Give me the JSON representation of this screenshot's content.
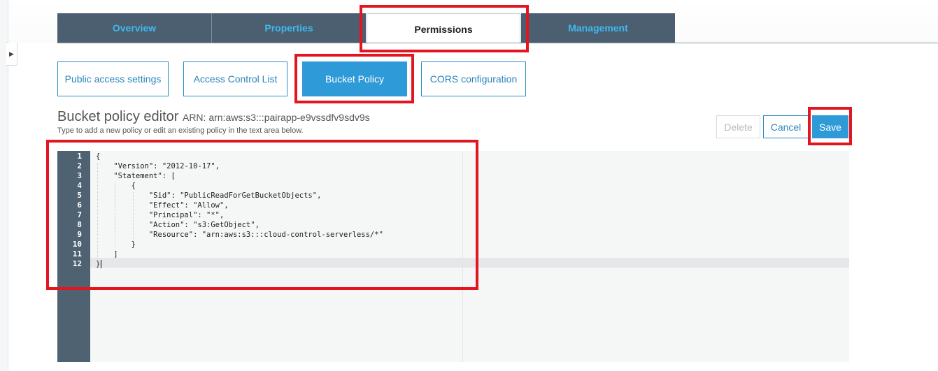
{
  "tabs": [
    {
      "label": "Overview",
      "active": false
    },
    {
      "label": "Properties",
      "active": false
    },
    {
      "label": "Permissions",
      "active": true
    },
    {
      "label": "Management",
      "active": false
    }
  ],
  "subtabs": [
    {
      "label": "Public access settings",
      "active": false
    },
    {
      "label": "Access Control List",
      "active": false
    },
    {
      "label": "Bucket Policy",
      "active": true
    },
    {
      "label": "CORS configuration",
      "active": false
    }
  ],
  "editor": {
    "title": "Bucket policy editor",
    "arn": "ARN: arn:aws:s3:::pairapp-e9vssdfv9sdv9s",
    "help": "Type to add a new policy or edit an existing policy in the text area below.",
    "current_line": 12,
    "lines": [
      "{",
      "    \"Version\": \"2012-10-17\",",
      "    \"Statement\": [",
      "        {",
      "            \"Sid\": \"PublicReadForGetBucketObjects\",",
      "            \"Effect\": \"Allow\",",
      "            \"Principal\": \"*\",",
      "            \"Action\": \"s3:GetObject\",",
      "            \"Resource\": \"arn:aws:s3:::cloud-control-serverless/*\"",
      "        }",
      "    ]",
      "}"
    ]
  },
  "buttons": {
    "delete": "Delete",
    "cancel": "Cancel",
    "save": "Save"
  },
  "colors": {
    "tab_bg": "#4b5f70",
    "tab_text": "#3fb9ef",
    "accent": "#2f9ad8",
    "highlight": "#e3161f"
  },
  "icons": {
    "collapse_handle": "caret-right-icon"
  }
}
